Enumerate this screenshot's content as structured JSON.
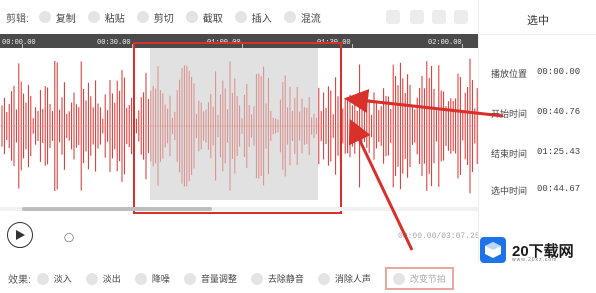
{
  "toolbar": {
    "label": "剪辑:",
    "items": [
      {
        "label": "复制",
        "icon": "copy-icon"
      },
      {
        "label": "粘贴",
        "icon": "paste-icon"
      },
      {
        "label": "剪切",
        "icon": "cut-icon"
      },
      {
        "label": "截取",
        "icon": "crop-icon"
      },
      {
        "label": "插入",
        "icon": "insert-icon"
      },
      {
        "label": "混流",
        "icon": "mix-icon"
      }
    ]
  },
  "ruler": {
    "labels": [
      "00:00.00",
      "00:30.00",
      "01:00.00",
      "01:30.00",
      "02:00.00"
    ]
  },
  "playback": {
    "total_time": "00:00.00/03:07.25"
  },
  "effects": {
    "label": "效果:",
    "items": [
      {
        "label": "淡入",
        "icon": "fade-in-icon"
      },
      {
        "label": "淡出",
        "icon": "fade-out-icon"
      },
      {
        "label": "降噪",
        "icon": "denoise-icon"
      },
      {
        "label": "音量调整",
        "icon": "volume-icon"
      },
      {
        "label": "去除静音",
        "icon": "remove-silence-icon"
      },
      {
        "label": "消除人声",
        "icon": "remove-vocal-icon"
      },
      {
        "label": "改变节拍",
        "icon": "tempo-icon"
      }
    ]
  },
  "panel": {
    "title": "选中",
    "rows": [
      {
        "label": "播放位置",
        "value": "00:00.00"
      },
      {
        "label": "开始时间",
        "value": "00:40.76"
      },
      {
        "label": "结束时间",
        "value": "01:25.43"
      },
      {
        "label": "选中时间",
        "value": "00:44.67"
      }
    ]
  },
  "watermark": {
    "brand": "20下载网",
    "url": "www.20xz.com"
  },
  "colors": {
    "waveform": "#d9302c",
    "ruler_bg": "#4a4a4a",
    "annotation": "#d9302c",
    "brand_blue": "#1e73e8"
  }
}
